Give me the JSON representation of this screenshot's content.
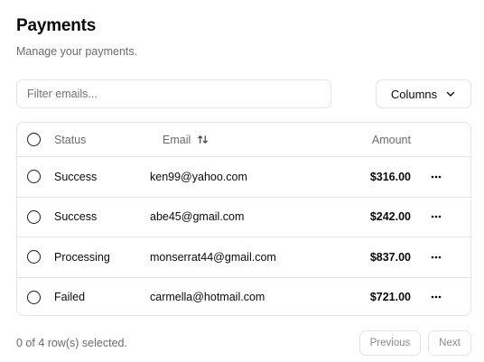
{
  "page": {
    "title": "Payments",
    "subtitle": "Manage your payments."
  },
  "toolbar": {
    "filter_placeholder": "Filter emails...",
    "columns_label": "Columns",
    "columns_icon": "chevron-down-icon"
  },
  "table": {
    "headers": {
      "status": "Status",
      "email": "Email",
      "amount": "Amount"
    },
    "sort_icon": "sort-arrows-icon",
    "row_menu_icon": "more-horizontal-icon",
    "rows": [
      {
        "status": "Success",
        "email": "ken99@yahoo.com",
        "amount": "$316.00"
      },
      {
        "status": "Success",
        "email": "abe45@gmail.com",
        "amount": "$242.00"
      },
      {
        "status": "Processing",
        "email": "monserrat44@gmail.com",
        "amount": "$837.00"
      },
      {
        "status": "Failed",
        "email": "carmella@hotmail.com",
        "amount": "$721.00"
      }
    ]
  },
  "footer": {
    "selection_text": "0 of 4 row(s) selected.",
    "previous_label": "Previous",
    "next_label": "Next"
  }
}
